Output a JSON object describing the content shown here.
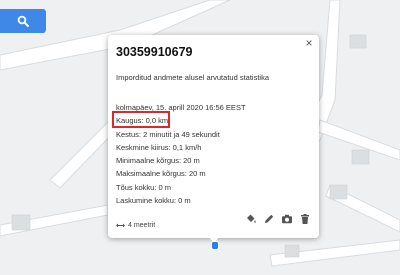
{
  "colors": {
    "accent": "#3f88e8",
    "highlight": "#d92b2b",
    "marker": "#2f7ee6"
  },
  "search": {
    "icon": "search-icon"
  },
  "popup": {
    "title": "30359910679",
    "subtitle": "Imporditud andmete alusel arvutatud statistika",
    "close": "×",
    "stats": [
      "kolmapäev, 15. aprill 2020 16:56 EEST",
      "Kaugus: 0,0 km",
      "Kestus: 2 minutit ja 49 sekundit",
      "Keskmine kiirus: 0,1 km/h",
      "Minimaalne kõrgus: 20 m",
      "Maksimaalne kõrgus: 20 m",
      "Tõus kokku: 0 m",
      "Laskumine kokku: 0 m"
    ],
    "scale": "4 meetrit",
    "actions": [
      "fill-color-icon",
      "edit-icon",
      "camera-icon",
      "delete-icon"
    ]
  }
}
